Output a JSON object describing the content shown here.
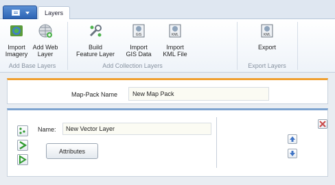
{
  "ribbon_tabs": {
    "app_menu_icon": "document-icon",
    "active_tab": "Layers"
  },
  "ribbon": {
    "groups": [
      {
        "title": "Add Base Layers",
        "buttons": [
          {
            "line1": "Import",
            "line2": "Imagery",
            "icon": "globe-image-icon"
          },
          {
            "line1": "Add Web",
            "line2": "Layer",
            "icon": "web-globe-icon"
          }
        ]
      },
      {
        "title": "Add Collection Layers",
        "buttons": [
          {
            "line1": "Build",
            "line2": "Feature Layer",
            "icon": "wrench-build-icon"
          },
          {
            "line1": "Import",
            "line2": "GIS Data",
            "icon": "gis-file-icon"
          },
          {
            "line1": "Import",
            "line2": "KML File",
            "icon": "kml-file-icon"
          }
        ]
      },
      {
        "title": "Export Layers",
        "buttons": [
          {
            "line1": "Export",
            "line2": "",
            "icon": "kml-export-icon"
          }
        ]
      }
    ]
  },
  "map_pack": {
    "label": "Map-Pack Name",
    "value": "New Map Pack"
  },
  "layer_item": {
    "name_label": "Name:",
    "name_value": "New Vector Layer",
    "attributes_button": "Attributes",
    "colors": {
      "accent_orange": "#f0a030",
      "accent_blue": "#7da3cf",
      "green": "#2f9b2f",
      "delete_red": "#c94b4b",
      "arrow_blue": "#3f74c5"
    }
  }
}
